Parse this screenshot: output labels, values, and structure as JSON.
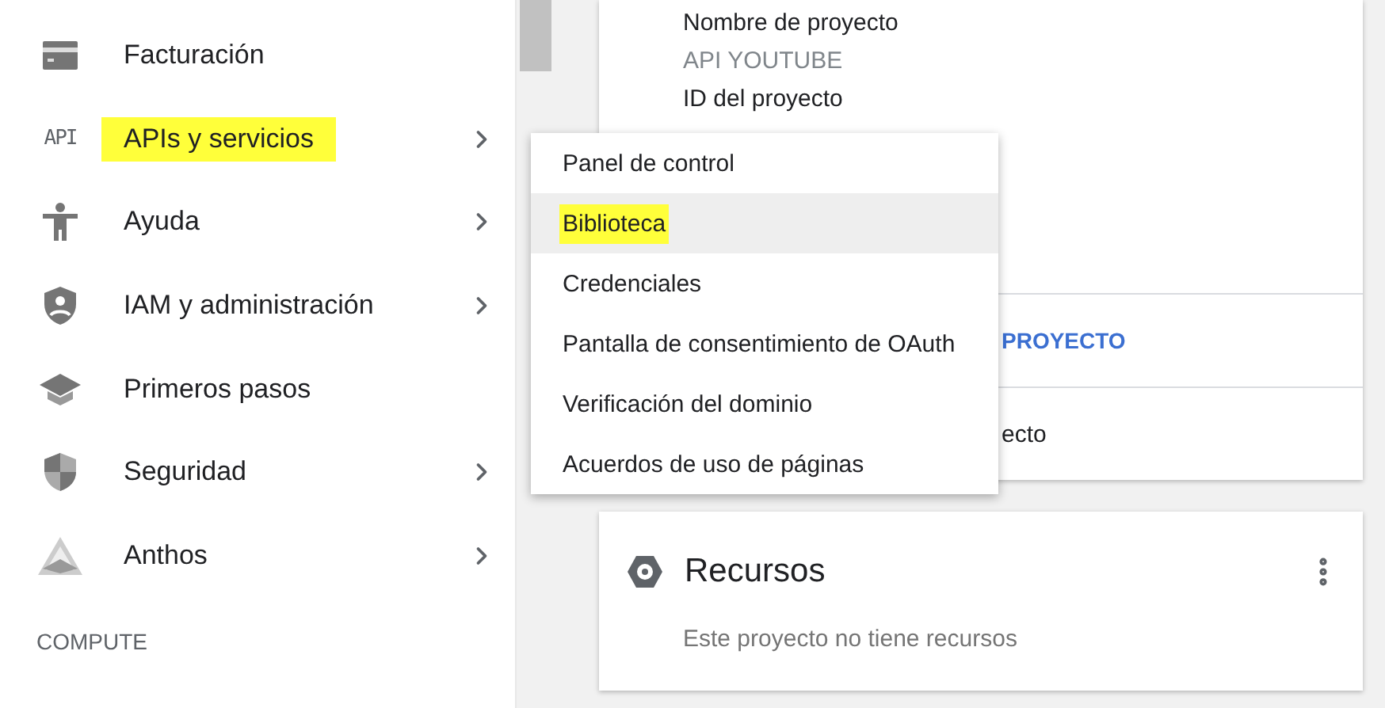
{
  "sidebar": {
    "items": [
      {
        "label": "Facturación",
        "has_submenu": false,
        "highlighted": false
      },
      {
        "icon_text": "API",
        "label": "APIs y servicios",
        "has_submenu": true,
        "highlighted": true
      },
      {
        "label": "Ayuda",
        "has_submenu": true,
        "highlighted": false
      },
      {
        "label": "IAM y administración",
        "has_submenu": true,
        "highlighted": false
      },
      {
        "label": "Primeros pasos",
        "has_submenu": false,
        "highlighted": false
      },
      {
        "label": "Seguridad",
        "has_submenu": true,
        "highlighted": false
      },
      {
        "label": "Anthos",
        "has_submenu": true,
        "highlighted": false
      }
    ],
    "section_label": "COMPUTE"
  },
  "project_card": {
    "name_label": "Nombre de proyecto",
    "name_value": "API YOUTUBE",
    "id_label": "ID del proyecto",
    "link": "PROYECTO",
    "row_text": "ecto"
  },
  "submenu": {
    "items": [
      {
        "label": "Panel de control",
        "selected": false,
        "highlighted": false
      },
      {
        "label": "Biblioteca",
        "selected": true,
        "highlighted": true
      },
      {
        "label": "Credenciales",
        "selected": false,
        "highlighted": false
      },
      {
        "label": "Pantalla de consentimiento de OAuth",
        "selected": false,
        "highlighted": false
      },
      {
        "label": "Verificación del dominio",
        "selected": false,
        "highlighted": false
      },
      {
        "label": "Acuerdos de uso de páginas",
        "selected": false,
        "highlighted": false
      }
    ]
  },
  "resources_card": {
    "title": "Recursos",
    "message": "Este proyecto no tiene recursos"
  }
}
